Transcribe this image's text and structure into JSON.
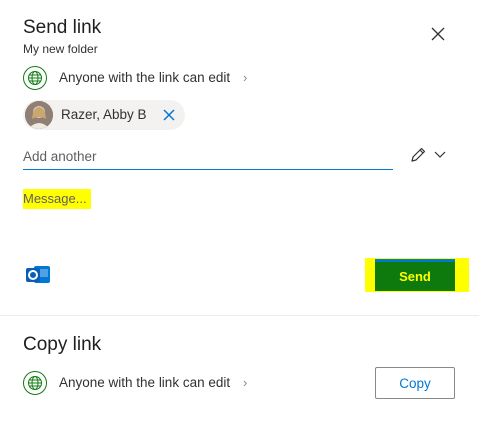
{
  "send_link": {
    "title": "Send link",
    "subtitle": "My new folder",
    "permission": "Anyone with the link can edit",
    "recipient": {
      "name": "Razer, Abby B"
    },
    "add_placeholder": "Add another",
    "message_placeholder": "Message...",
    "send_label": "Send"
  },
  "copy_link": {
    "title": "Copy link",
    "permission": "Anyone with the link can edit",
    "copy_label": "Copy"
  },
  "colors": {
    "accent": "#0078d4",
    "send_button": "#0e7a0e",
    "highlight": "#ffff00",
    "globe": "#107c10"
  },
  "icons": {
    "close": "close-icon",
    "globe": "globe-icon",
    "remove": "remove-recipient-icon",
    "edit": "pencil-icon",
    "dropdown": "chevron-down-icon",
    "outlook": "outlook-icon"
  }
}
